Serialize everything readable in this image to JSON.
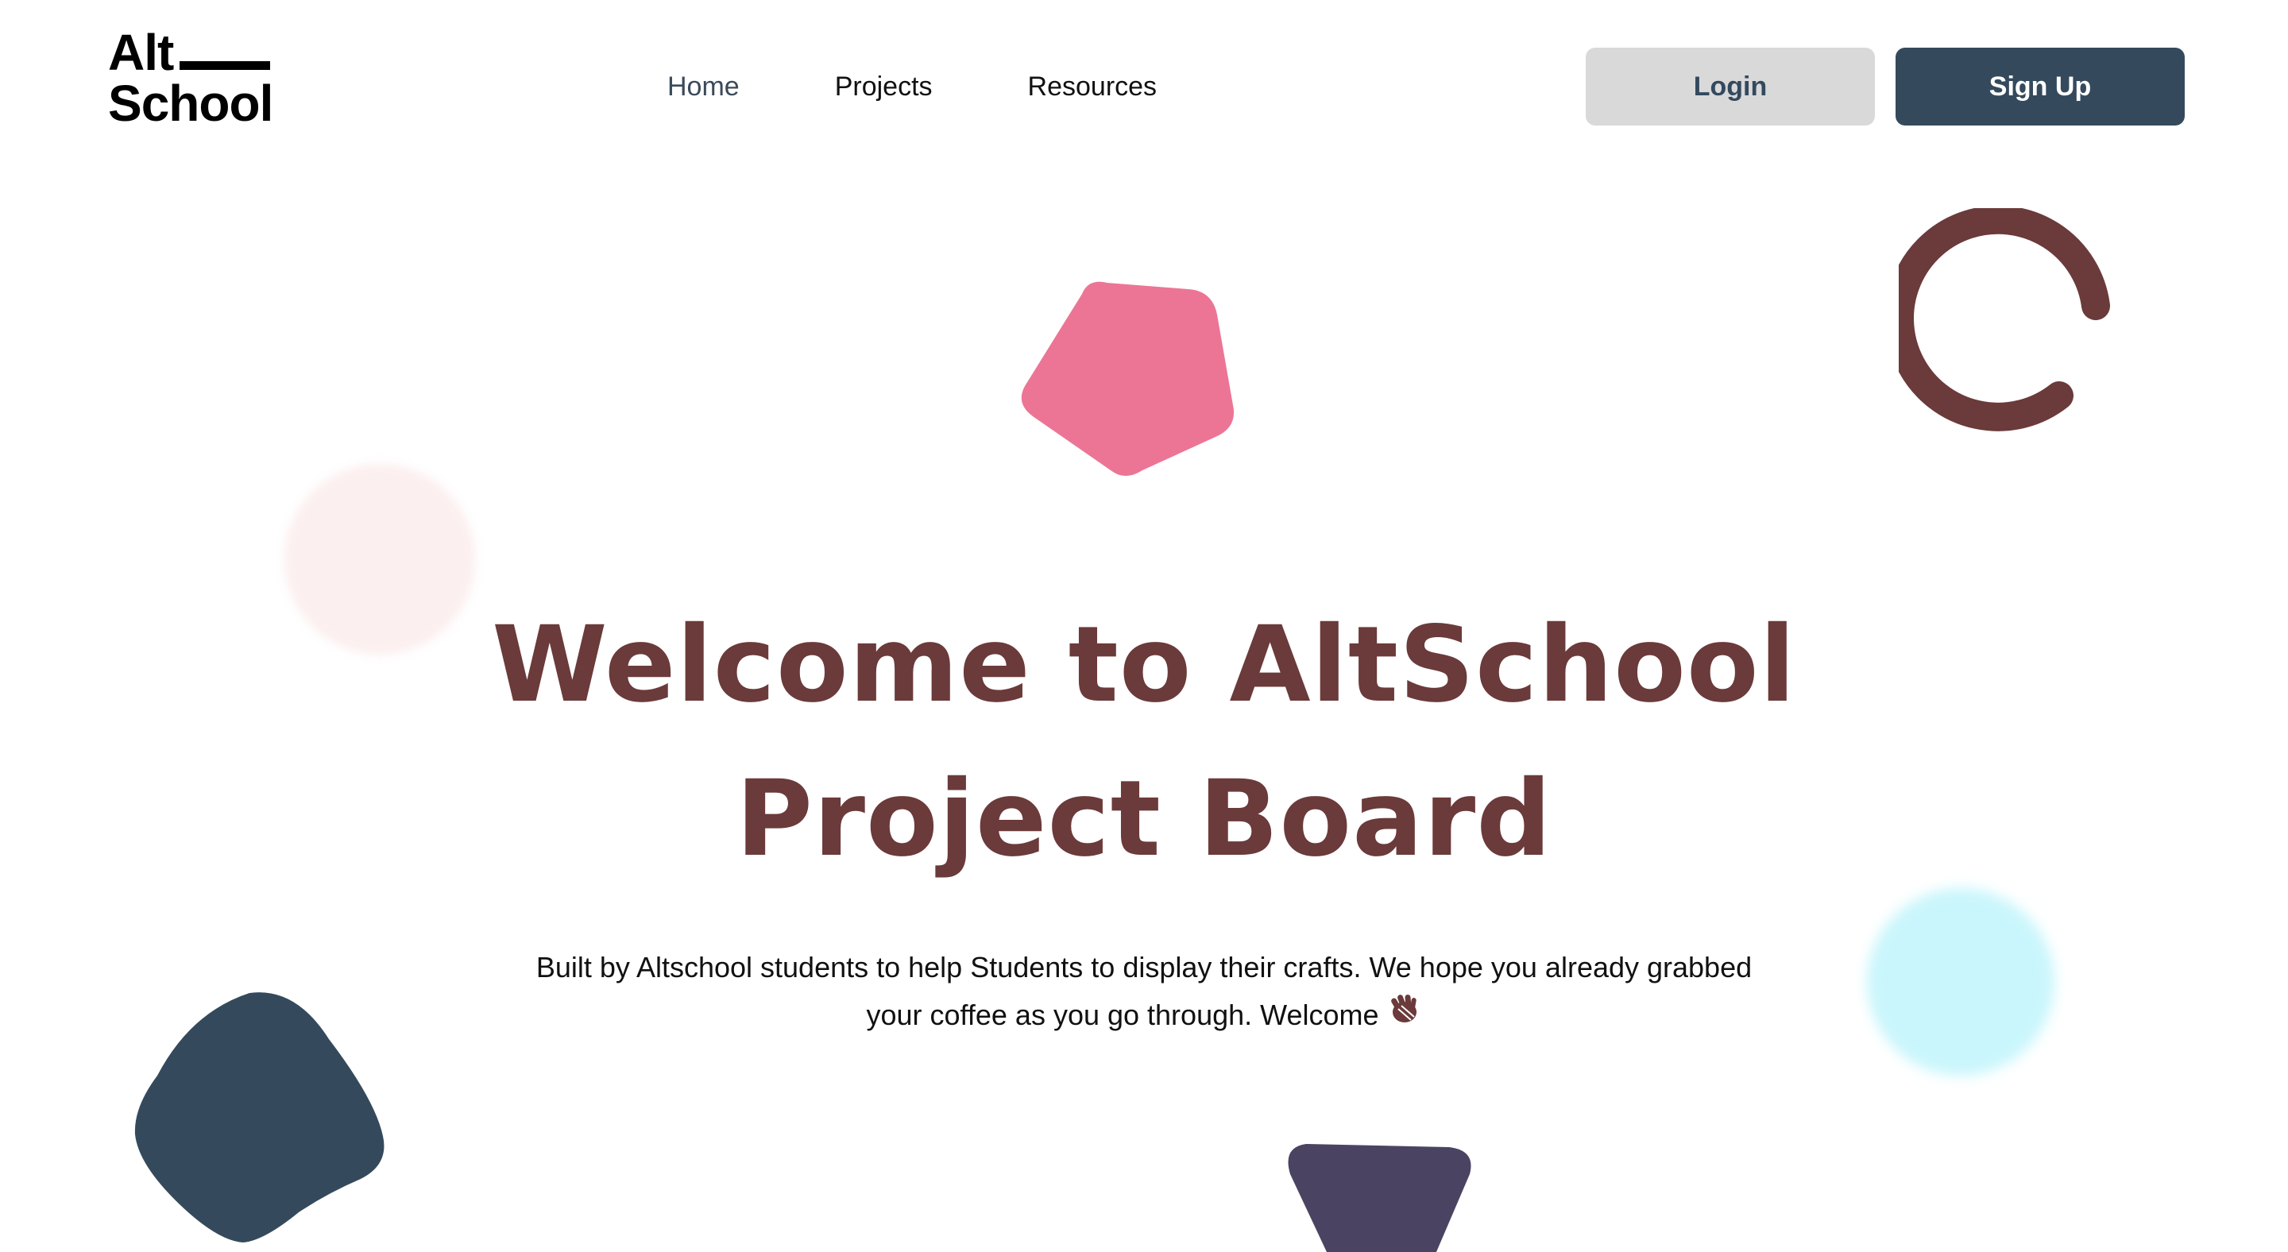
{
  "logo": {
    "line1": "Alt",
    "line2": "School"
  },
  "nav": {
    "items": [
      {
        "label": "Home"
      },
      {
        "label": "Projects"
      },
      {
        "label": "Resources"
      }
    ]
  },
  "auth": {
    "login_label": "Login",
    "signup_label": "Sign Up"
  },
  "hero": {
    "title_line1": "Welcome to AltSchool",
    "title_line2": "Project Board",
    "subtitle": "Built by Altschool students to help Students to display their crafts. We hope you already grabbed your coffee as you go through. Welcome"
  },
  "colors": {
    "title": "#6b3a3a",
    "signup_bg": "#344a5c",
    "login_bg": "#d9d9d9",
    "pink_shape": "#ec7596",
    "ring": "#6b3a3a",
    "dark_blob": "#344a5c",
    "purple_shape": "#4a4462",
    "blur_pink": "#fcefef",
    "blur_cyan": "#c9f6fc"
  },
  "icons": {
    "wave": "waving-hand-icon"
  }
}
